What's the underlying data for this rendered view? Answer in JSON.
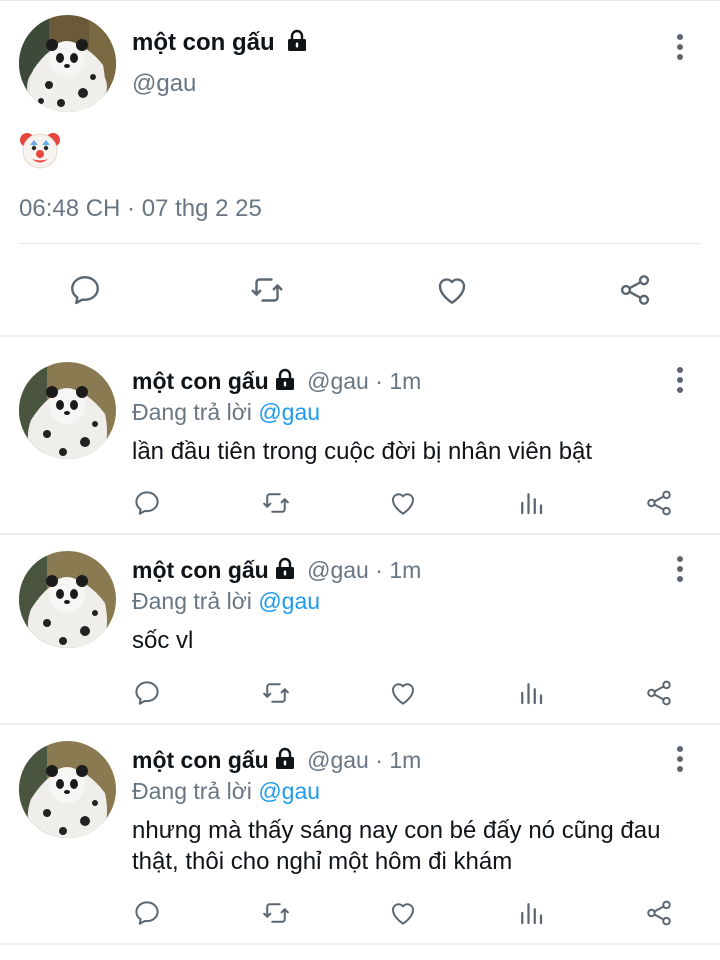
{
  "main_tweet": {
    "author_name": "một con gấu",
    "handle": "@gau",
    "content_emoji": "clown-face",
    "timestamp": "06:48 CH · 07 thg 2 25",
    "actions": [
      "reply",
      "retweet",
      "like",
      "share"
    ]
  },
  "replies": [
    {
      "author_name": "một con gấu",
      "handle": "@gau",
      "separator": "·",
      "time": "1m",
      "replying_prefix": "Đang trả lời",
      "replying_to": "@gau",
      "text": "lần đầu tiên trong cuộc đời bị nhân viên bật"
    },
    {
      "author_name": "một con gấu",
      "handle": "@gau",
      "separator": "·",
      "time": "1m",
      "replying_prefix": "Đang trả lời",
      "replying_to": "@gau",
      "text": "sốc vl"
    },
    {
      "author_name": "một con gấu",
      "handle": "@gau",
      "separator": "·",
      "time": "1m",
      "replying_prefix": "Đang trả lời",
      "replying_to": "@gau",
      "text": "nhưng mà thấy sáng nay con bé đấy nó cũng đau thật, thôi cho nghỉ một hôm đi khám"
    }
  ],
  "colors": {
    "text": "#0f1419",
    "muted": "#687684",
    "link": "#1d9bf0",
    "divider": "#e1e8ed"
  },
  "icons": [
    "lock-icon",
    "more-vertical-icon",
    "reply-icon",
    "retweet-icon",
    "like-icon",
    "views-icon",
    "share-icon"
  ]
}
